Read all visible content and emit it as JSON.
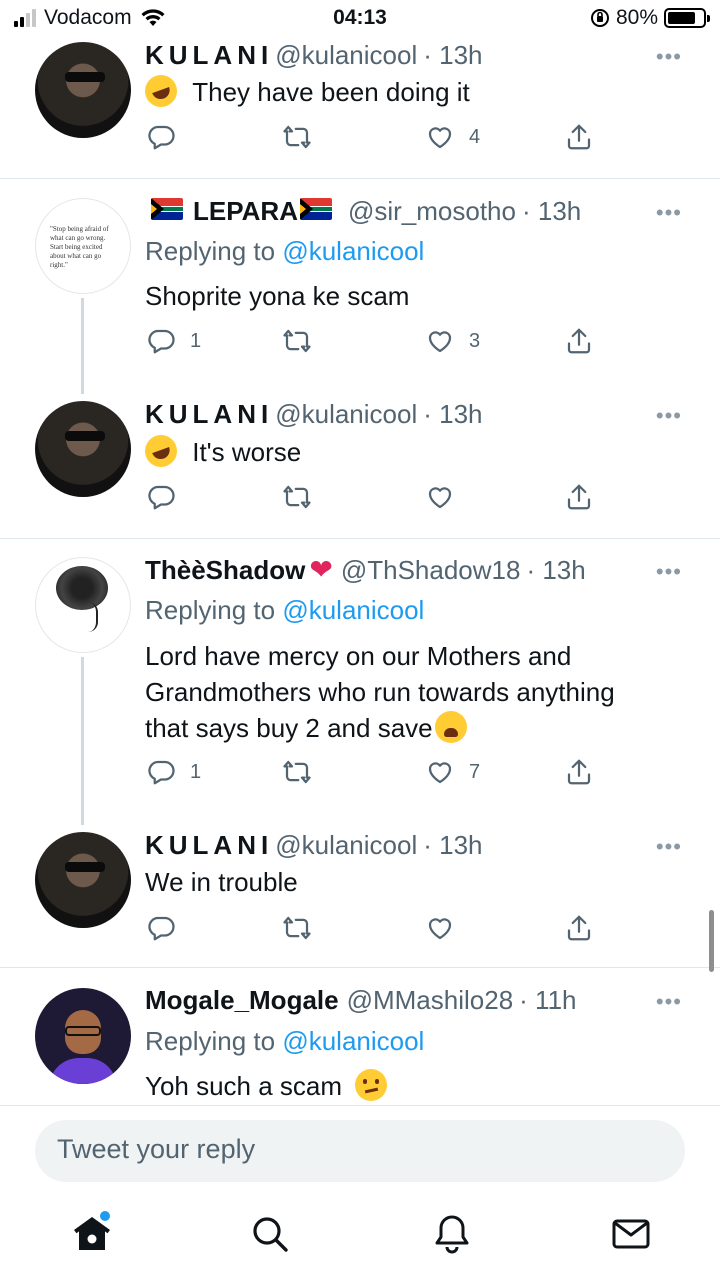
{
  "status_bar": {
    "carrier": "Vodacom",
    "time": "04:13",
    "battery": "80%",
    "battery_level": 0.8
  },
  "tweets": [
    {
      "name": "KULANI",
      "handle": "@kulanicool",
      "time": "· 13h",
      "text": "They have been doing it",
      "reply_count": "",
      "retweet_count": "",
      "like_count": "4",
      "emoji": "rolling-on-floor-laughing"
    },
    {
      "name": "LEPARA",
      "handle": "@sir_mosotho",
      "time": "· 13h",
      "replying_prefix": "Replying to",
      "replying_to": "@kulanicool",
      "text": "Shoprite yona ke scam",
      "reply_count": "1",
      "retweet_count": "",
      "like_count": "3",
      "avatar_quote": "\"Stop being afraid of what can go wrong. Start being excited about what can go right.\""
    },
    {
      "name": "KULANI",
      "handle": "@kulanicool",
      "time": "· 13h",
      "text": "It's worse",
      "reply_count": "",
      "retweet_count": "",
      "like_count": "",
      "emoji": "rolling-on-floor-laughing"
    },
    {
      "name": "ThèèShadow",
      "handle": "@ThShadow18",
      "time": "· 13h",
      "replying_prefix": "Replying to",
      "replying_to": "@kulanicool",
      "text_line1": "Lord have mercy on our Mothers and",
      "text_line2": "Grandmothers who run towards anything",
      "text_line3": "that says buy 2 and save",
      "reply_count": "1",
      "retweet_count": "",
      "like_count": "7",
      "name_emoji": "red-heart",
      "emoji": "weary-face"
    },
    {
      "name": "KULANI",
      "handle": "@kulanicool",
      "time": "· 13h",
      "text": "We in trouble",
      "reply_count": "",
      "retweet_count": "",
      "like_count": ""
    },
    {
      "name": "Mogale_Mogale",
      "handle": "@MMashilo28",
      "time": "· 11h",
      "replying_prefix": "Replying to",
      "replying_to": "@kulanicool",
      "text": "Yoh such a scam",
      "emoji": "confused-face"
    }
  ],
  "composer": {
    "placeholder": "Tweet your reply"
  },
  "tab_bar": {
    "items": [
      "home-icon",
      "search-icon",
      "notifications-icon",
      "messages-icon"
    ],
    "home_badge": true
  },
  "colors": {
    "accent": "#1d9bf0",
    "text": "#0f1419",
    "muted": "#536471"
  }
}
